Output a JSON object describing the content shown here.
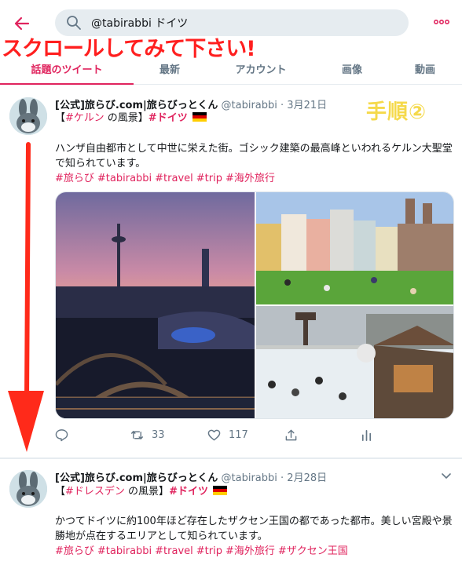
{
  "search": {
    "query": "@tabirabbi ドイツ"
  },
  "overlay": {
    "scroll_hint": "スクロールしてみて下さい!",
    "step_label": "手順②"
  },
  "tabs": [
    {
      "label": "話題のツイート",
      "active": true
    },
    {
      "label": "最新",
      "active": false
    },
    {
      "label": "アカウント",
      "active": false
    },
    {
      "label": "画像",
      "active": false
    },
    {
      "label": "動画",
      "active": false
    }
  ],
  "tweets": [
    {
      "name": "[公式]旅らび.com|旅らびっとくん",
      "handle": "@tabirabbi",
      "dot": "·",
      "date": "3月21日",
      "line2_open": "【",
      "line2_tag": "#ケルン",
      "line2_text": " の風景】",
      "line2_tag2": "#ドイツ",
      "text": "ハンザ自由都市として中世に栄えた街。ゴシック建築の最高峰といわれるケルン大聖堂で知られています。",
      "hashtags": [
        "#旅らび",
        "#tabirabbi",
        "#travel",
        "#trip",
        "#海外旅行"
      ],
      "actions": {
        "replies": "",
        "retweets": "33",
        "likes": "117"
      }
    },
    {
      "name": "[公式]旅らび.com|旅らびっとくん",
      "handle": "@tabirabbi",
      "dot": "·",
      "date": "2月28日",
      "line2_open": "【",
      "line2_tag": "#ドレスデン",
      "line2_text": " の風景】",
      "line2_tag2": "#ドイツ",
      "text": "かつてドイツに約100年ほど存在したザクセン王国の都であった都市。美しい宮殿や景勝地が点在するエリアとして知られています。",
      "hashtags": [
        "#旅らび",
        "#tabirabbi",
        "#travel",
        "#trip",
        "#海外旅行",
        "#ザクセン王国"
      ]
    }
  ],
  "colors": {
    "accent": "#e0245e",
    "overlay_red": "#ff1f1f",
    "step_yellow": "#f5d94a",
    "muted": "#657786"
  },
  "icons": [
    "back-arrow-icon",
    "search-icon",
    "more-icon",
    "reply-icon",
    "retweet-icon",
    "like-icon",
    "share-icon",
    "analytics-icon",
    "chevron-down-icon",
    "germany-flag-icon"
  ]
}
